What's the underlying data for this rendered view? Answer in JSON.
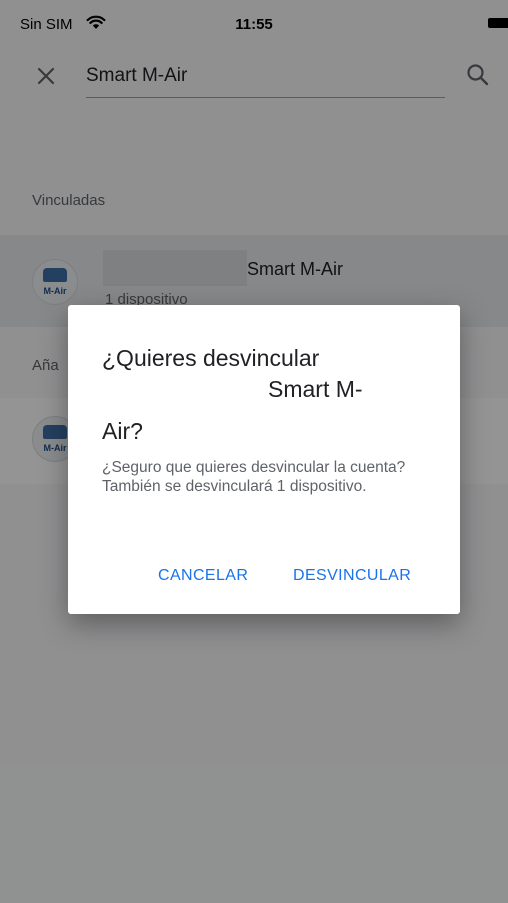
{
  "status_bar": {
    "carrier": "Sin SIM",
    "time": "11:55"
  },
  "header": {
    "search_value": "Smart M-Air"
  },
  "sections": {
    "linked_title": "Vinculadas",
    "added_title_partial": "Aña"
  },
  "linked_item": {
    "name": "Smart M-Air",
    "subtitle": "1 dispositivo",
    "logo_text": "M-Air"
  },
  "added_item": {
    "logo_text": "M-Air"
  },
  "dialog": {
    "title_line1": "¿Quieres desvincular",
    "title_line2": "Smart M-",
    "title_line3": "Air?",
    "body": "¿Seguro que quieres desvincular la cuenta? También se desvinculará 1 dispositivo.",
    "cancel_label": "CANCELAR",
    "confirm_label": "DESVINCULAR"
  },
  "colors": {
    "accent": "#1a73e8",
    "overlay": "rgba(0,0,0,0.42)"
  }
}
